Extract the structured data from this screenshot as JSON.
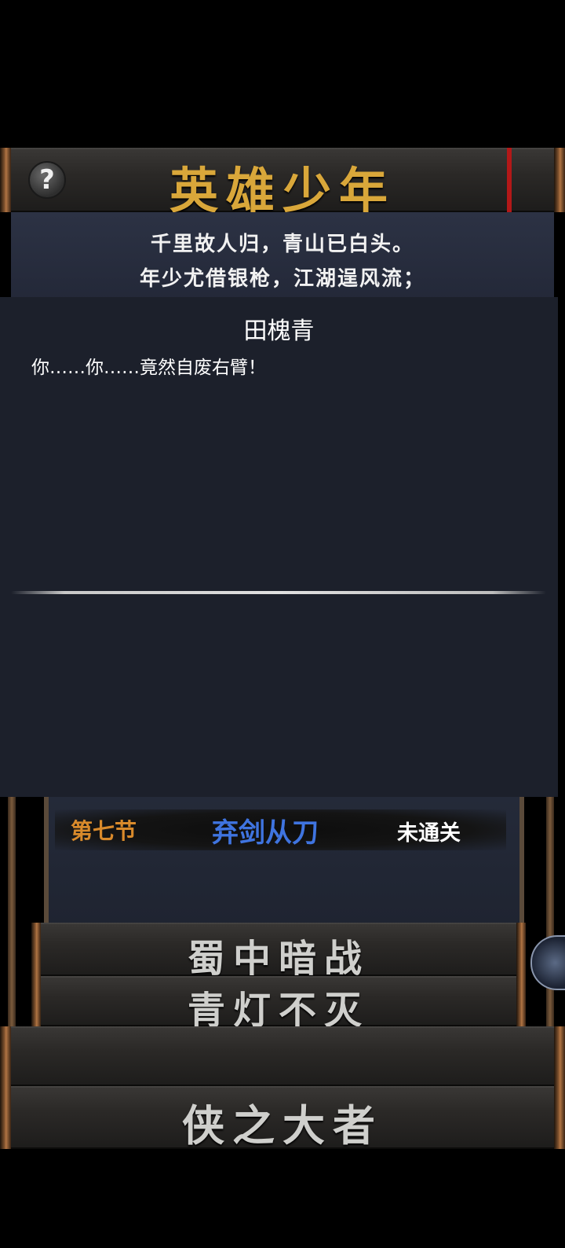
{
  "header": {
    "title": "英雄少年",
    "help_label": "?"
  },
  "poem": {
    "lines": [
      "千里故人归，青山已白头。",
      "年少尤借银枪，江湖逞风流；"
    ]
  },
  "dialog": {
    "speaker": "田槐青",
    "text": "你……你……竟然自废右臂！"
  },
  "chapter": {
    "section": "第七节",
    "name": "弃剑从刀",
    "status": "未通关"
  },
  "stages": {
    "items": [
      "蜀中暗战",
      "青灯不灭"
    ]
  },
  "bottom": {
    "title": "侠之大者"
  },
  "colors": {
    "title_gold": "#d9a73a",
    "section_orange": "#d98a2b",
    "chapter_blue": "#3f74e0",
    "ribbon_red": "#b31818",
    "dialog_bg": "#1c202b"
  }
}
